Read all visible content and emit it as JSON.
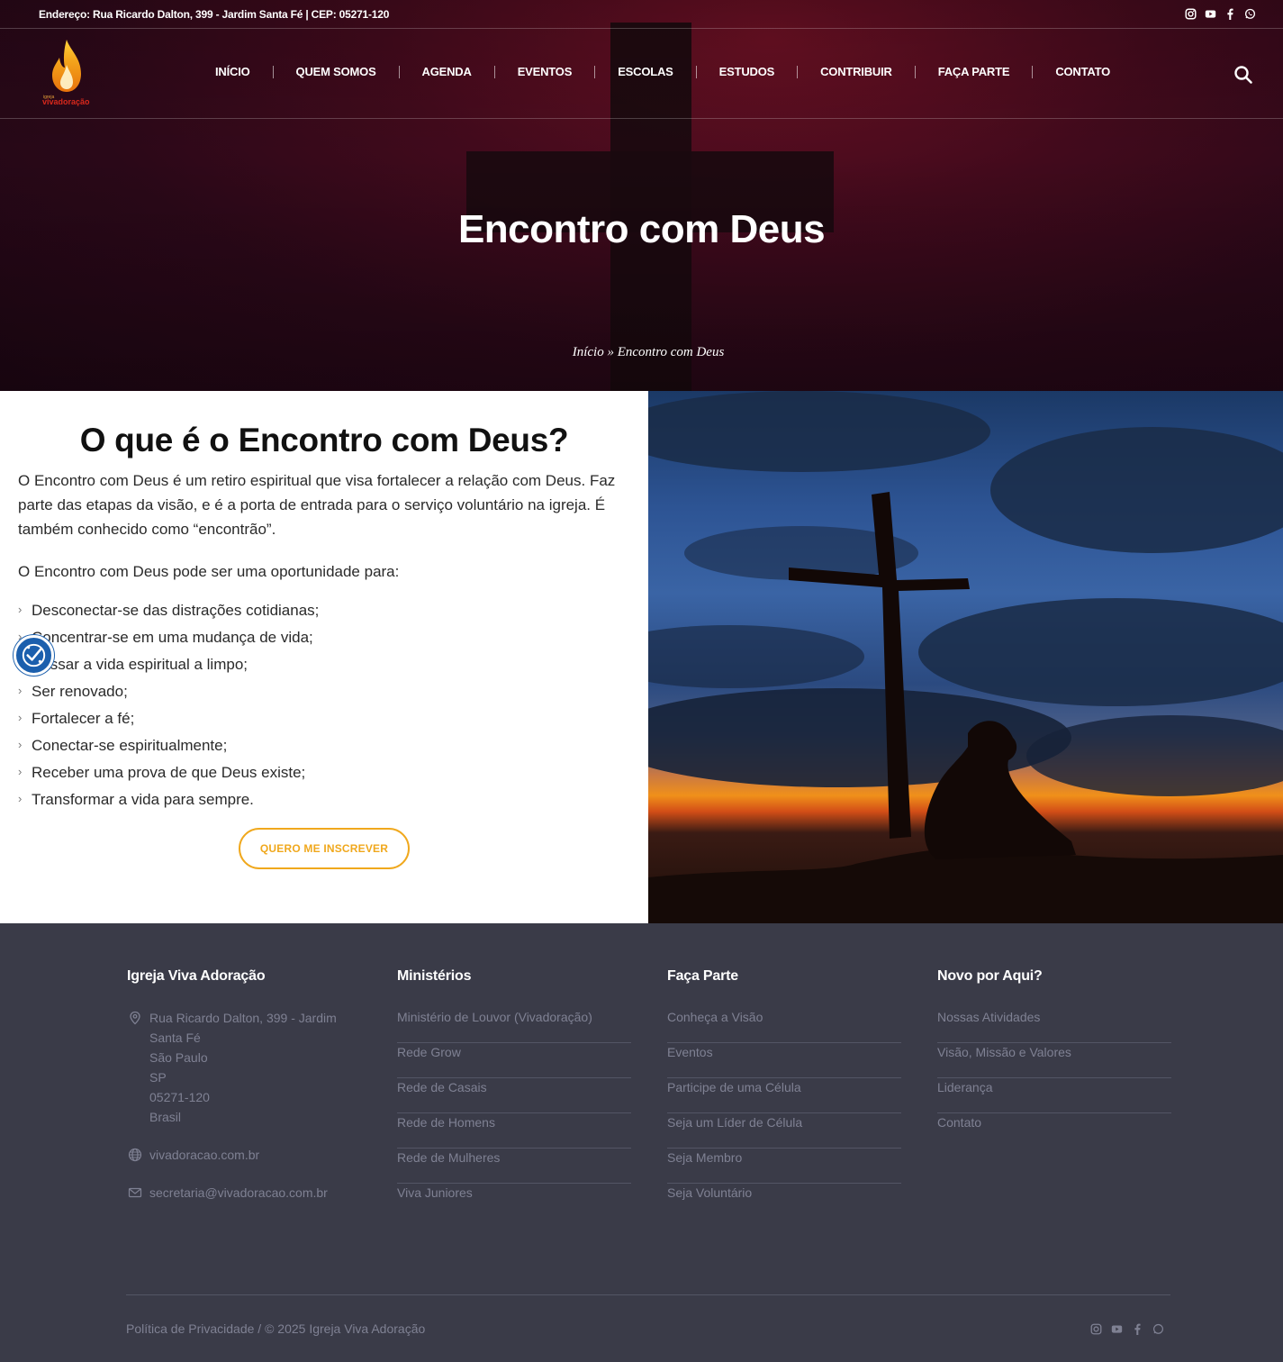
{
  "topbar": {
    "address": "Endereço: Rua Ricardo Dalton, 399 - Jardim Santa Fé | CEP: 05271-120",
    "socials": [
      "instagram-icon",
      "youtube-icon",
      "facebook-icon",
      "whatsapp-icon"
    ]
  },
  "logo": {
    "small": "igreja",
    "name": "vivadoração"
  },
  "nav": {
    "items": [
      "INÍCIO",
      "QUEM SOMOS",
      "AGENDA",
      "EVENTOS",
      "ESCOLAS",
      "ESTUDOS",
      "CONTRIBUIR",
      "FAÇA PARTE",
      "CONTATO"
    ]
  },
  "hero": {
    "title": "Encontro com Deus",
    "breadcrumb_home": "Início",
    "breadcrumb_sep": "»",
    "breadcrumb_current": "Encontro com Deus"
  },
  "main": {
    "heading": "O que é o Encontro com Deus?",
    "paragraph1": "O Encontro com Deus é um retiro espiritual que visa fortalecer a relação com Deus. Faz parte das etapas da visão, e é a porta de entrada para o serviço voluntário na igreja. É também conhecido como “encontrão”.",
    "paragraph2": "O Encontro com Deus pode ser uma oportunidade para:",
    "list": [
      "Desconectar-se das distrações cotidianas;",
      "Concentrar-se em uma mudança de vida;",
      "Passar a vida espiritual a limpo;",
      "Ser renovado;",
      "Fortalecer a fé;",
      "Conectar-se espiritualmente;",
      "Receber uma prova de que Deus existe;",
      "Transformar a vida para sempre."
    ],
    "cta": "QUERO ME INSCREVER"
  },
  "colors": {
    "accent": "#f0a81d",
    "footer_bg": "#3a3b48",
    "hero_bg": "#420a1c",
    "a11y": "#1b5fad"
  },
  "footer": {
    "col1": {
      "title": "Igreja Viva Adoração",
      "address": [
        "Rua Ricardo Dalton, 399 - Jardim",
        "Santa Fé",
        "São Paulo",
        "SP",
        "05271-120",
        "Brasil"
      ],
      "website": "vivadoracao.com.br",
      "email": "secretaria@vivadoracao.com.br"
    },
    "col2": {
      "title": "Ministérios",
      "links": [
        "Ministério de Louvor (Vivadoração)",
        "Rede Grow",
        "Rede de Casais",
        "Rede de Homens",
        "Rede de Mulheres",
        "Viva Juniores"
      ]
    },
    "col3": {
      "title": "Faça Parte",
      "links": [
        "Conheça a Visão",
        "Eventos",
        "Participe de uma Célula",
        "Seja um Líder de Célula",
        "Seja Membro",
        "Seja Voluntário"
      ]
    },
    "col4": {
      "title": "Novo por Aqui?",
      "links": [
        "Nossas Atividades",
        "Visão, Missão e Valores",
        "Liderança",
        "Contato"
      ]
    },
    "copyright": "Política de Privacidade / © 2025 Igreja Viva Adoração"
  }
}
